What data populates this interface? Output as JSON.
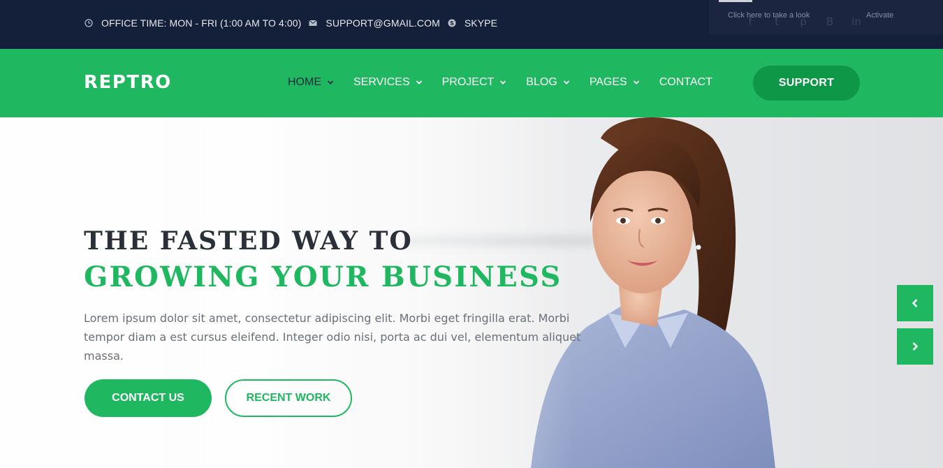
{
  "topbar": {
    "office_time": "OFFICE TIME: MON - FRI (1:00 AM TO 4:00)",
    "email": "SUPPORT@GMAIL.COM",
    "skype": "SKYPE",
    "icons": [
      "clock-icon",
      "envelope-icon",
      "skype-icon"
    ]
  },
  "promo": {
    "text": "Click here to take a look",
    "activate": "Activate",
    "socials": [
      "facebook-icon",
      "twitter-icon",
      "pinterest-icon",
      "behance-icon",
      "linkedin-icon"
    ]
  },
  "nav": {
    "logo": "REPTRO",
    "items": [
      {
        "label": "HOME",
        "dropdown": true,
        "active": true
      },
      {
        "label": "SERVICES",
        "dropdown": true
      },
      {
        "label": "PROJECT",
        "dropdown": true
      },
      {
        "label": "BLOG",
        "dropdown": true
      },
      {
        "label": "PAGES",
        "dropdown": true
      },
      {
        "label": "CONTACT",
        "dropdown": false
      }
    ],
    "support_label": "SUPPORT"
  },
  "hero": {
    "eyebrow": "THE FASTED WAY TO",
    "title": "GROWING YOUR BUSINESS",
    "description": "Lorem ipsum dolor sit amet, consectetur adipiscing elit. Morbi eget fringilla erat. Morbi tempor diam a est cursus eleifend. Integer odio nisi, porta ac dui vel, elementum aliquet massa.",
    "contact_label": "CONTACT US",
    "work_label": "RECENT WORK"
  },
  "colors": {
    "accent": "#1fb860",
    "accent_dark": "#0f9748",
    "topbar": "#14203a",
    "text_dark": "#2a2f38"
  }
}
